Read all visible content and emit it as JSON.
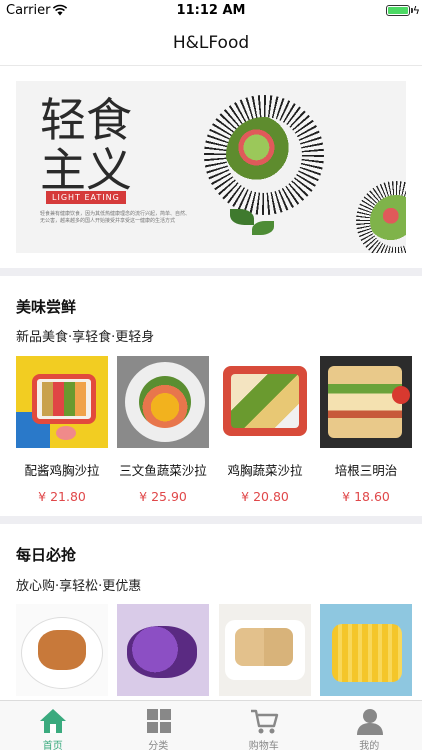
{
  "status_bar": {
    "carrier": "Carrier",
    "time": "11:12 AM"
  },
  "nav": {
    "title": "H&LFood"
  },
  "banner": {
    "title": "轻食主义",
    "subtitle": "LIGHT EATING",
    "description": "轻食兼有健康饮食，因为其低热健康理念的流行兴起，简单、自然、无公害，越来越多的国人开始接受并享受这一健康的生活方式"
  },
  "section1": {
    "title": "美味尝鲜",
    "subtitle": "新品美食·享轻食·更轻身",
    "items": [
      {
        "name": "配酱鸡胸沙拉",
        "price": "¥ 21.80"
      },
      {
        "name": "三文鱼蔬菜沙拉",
        "price": "¥ 25.90"
      },
      {
        "name": "鸡胸蔬菜沙拉",
        "price": "¥ 20.80"
      },
      {
        "name": "培根三明治",
        "price": "¥ 18.60"
      }
    ]
  },
  "section2": {
    "title": "每日必抢",
    "subtitle": "放心购·享轻松·更优惠",
    "items": [
      {},
      {},
      {},
      {}
    ]
  },
  "tabs": [
    {
      "label": "首页",
      "icon": "home-icon",
      "active": true
    },
    {
      "label": "分类",
      "icon": "grid-icon",
      "active": false
    },
    {
      "label": "购物车",
      "icon": "cart-icon",
      "active": false
    },
    {
      "label": "我的",
      "icon": "person-icon",
      "active": false
    }
  ],
  "colors": {
    "accent": "#3aaa7e",
    "price": "#e0484a",
    "battery": "#4cd964"
  }
}
